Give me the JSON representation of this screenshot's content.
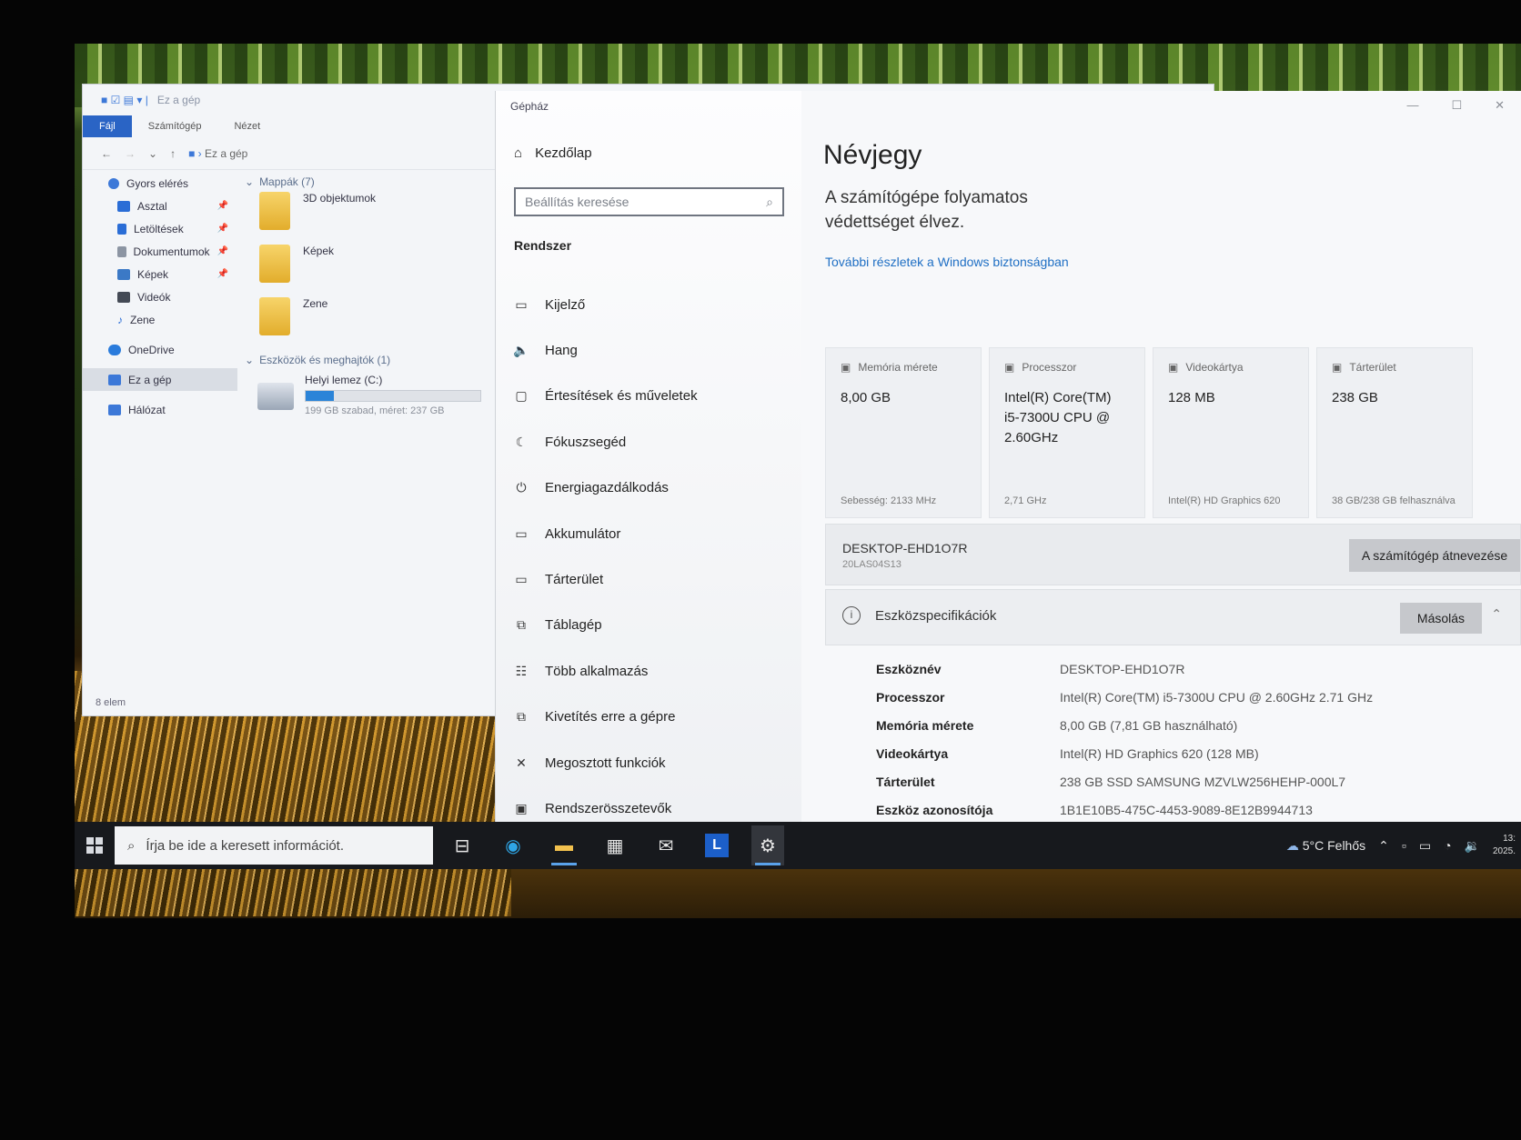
{
  "explorer": {
    "title": "Ez a gép",
    "ribbon": [
      "Fájl",
      "Számítógép",
      "Nézet"
    ],
    "address": "Ez a gép",
    "sidebar": [
      {
        "label": "Gyors elérés",
        "pin": false,
        "sub": false
      },
      {
        "label": "Asztal",
        "pin": true,
        "sub": true
      },
      {
        "label": "Letöltések",
        "pin": true,
        "sub": true
      },
      {
        "label": "Dokumentumok",
        "pin": true,
        "sub": true
      },
      {
        "label": "Képek",
        "pin": true,
        "sub": true
      },
      {
        "label": "Videók",
        "pin": false,
        "sub": true
      },
      {
        "label": "Zene",
        "pin": false,
        "sub": true
      },
      {
        "label": "OneDrive",
        "pin": false,
        "sub": false
      },
      {
        "label": "Ez a gép",
        "pin": false,
        "sub": false,
        "selected": true
      },
      {
        "label": "Hálózat",
        "pin": false,
        "sub": false
      }
    ],
    "folders_group": "Mappák (7)",
    "folders": [
      "3D objektumok",
      "Képek",
      "Zene"
    ],
    "devices_group": "Eszközök és meghajtók (1)",
    "drive": {
      "name": "Helyi lemez (C:)",
      "info": "199 GB szabad, méret: 237 GB",
      "used_fraction": 0.16
    },
    "status": "8 elem"
  },
  "settings": {
    "window_title": "Gépház",
    "home": "Kezdőlap",
    "search_placeholder": "Beállítás keresése",
    "section": "Rendszer",
    "nav": [
      {
        "label": "Kijelző",
        "icon": "monitor-icon",
        "glyph": "▭"
      },
      {
        "label": "Hang",
        "icon": "speaker-icon",
        "glyph": "🔈"
      },
      {
        "label": "Értesítések és műveletek",
        "icon": "notification-icon",
        "glyph": "▢"
      },
      {
        "label": "Fókuszsegéd",
        "icon": "moon-icon",
        "glyph": "☾"
      },
      {
        "label": "Energiagazdálkodás",
        "icon": "power-icon",
        "glyph": "⏻"
      },
      {
        "label": "Akkumulátor",
        "icon": "battery-icon",
        "glyph": "▭"
      },
      {
        "label": "Tárterület",
        "icon": "storage-icon",
        "glyph": "▭"
      },
      {
        "label": "Táblagép",
        "icon": "tablet-icon",
        "glyph": "⧉"
      },
      {
        "label": "Több alkalmazás",
        "icon": "multitasking-icon",
        "glyph": "☷"
      },
      {
        "label": "Kivetítés erre a gépre",
        "icon": "projecting-icon",
        "glyph": "⧉"
      },
      {
        "label": "Megosztott funkciók",
        "icon": "shared-icon",
        "glyph": "✕"
      },
      {
        "label": "Rendszerösszetevők",
        "icon": "components-icon",
        "glyph": "▣"
      }
    ],
    "about": {
      "heading": "Névjegy",
      "protection": "A számítógépe folyamatos védettséget élvez.",
      "link": "További részletek a Windows biztonságban",
      "cards": [
        {
          "title": "Memória mérete",
          "value": "8,00 GB",
          "sub": "Sebesség: 2133 MHz"
        },
        {
          "title": "Processzor",
          "value": "Intel(R) Core(TM) i5-7300U CPU @ 2.60GHz",
          "sub": "2,71 GHz"
        },
        {
          "title": "Videokártya",
          "value": "128 MB",
          "sub": "Intel(R) HD Graphics 620"
        },
        {
          "title": "Tárterület",
          "value": "238 GB",
          "sub": "38 GB/238 GB felhasználva"
        }
      ],
      "device_name": "DESKTOP-EHD1O7R",
      "device_model": "20LAS04S13",
      "rename_button": "A számítógép átnevezése",
      "spec_title": "Eszközspecifikációk",
      "copy_button": "Másolás",
      "specs": [
        {
          "k": "Eszköznév",
          "v": "DESKTOP-EHD1O7R"
        },
        {
          "k": "Processzor",
          "v": "Intel(R) Core(TM) i5-7300U CPU @ 2.60GHz   2.71 GHz"
        },
        {
          "k": "Memória mérete",
          "v": "8,00 GB (7,81 GB használható)"
        },
        {
          "k": "Videokártya",
          "v": "Intel(R) HD Graphics 620 (128 MB)"
        },
        {
          "k": "Tárterület",
          "v": "238 GB SSD SAMSUNG MZVLW256HEHP-000L7"
        },
        {
          "k": "Eszköz azonosítója",
          "v": "1B1E10B5-475C-4453-9089-8E12B9944713"
        }
      ]
    }
  },
  "taskbar": {
    "search_placeholder": "Írja be ide a keresett információt.",
    "weather": "5°C Felhős",
    "clock_time": "13:",
    "clock_date": "2025."
  }
}
